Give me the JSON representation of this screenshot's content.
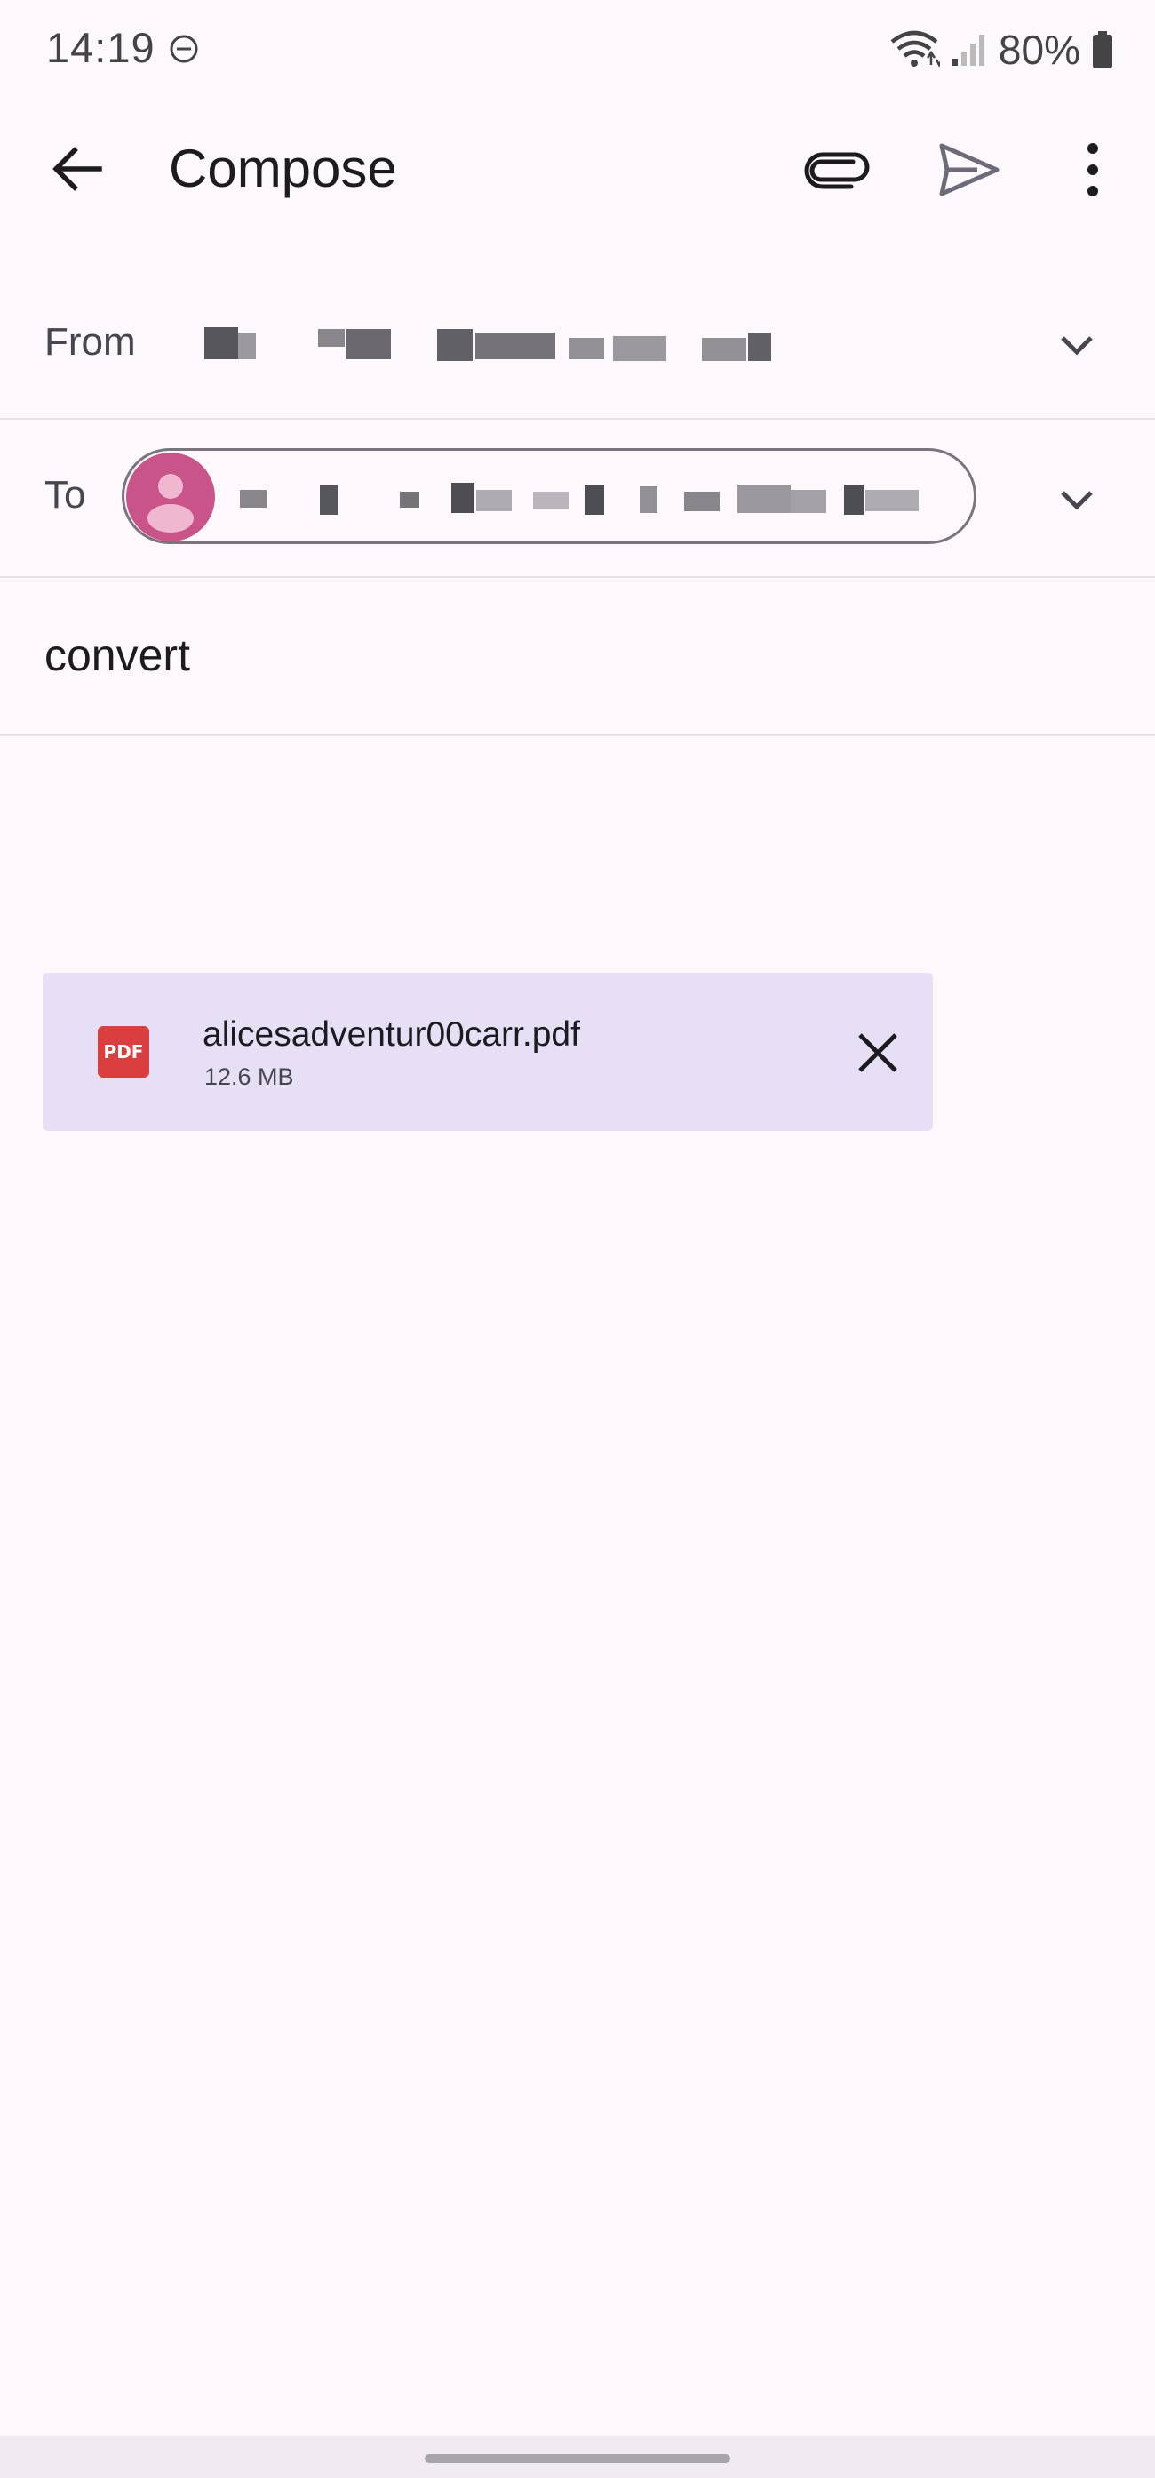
{
  "status_bar": {
    "time": "14:19",
    "battery_text": "80%",
    "icons": [
      "do-not-disturb-icon",
      "wifi-icon",
      "signal-icon",
      "battery-icon"
    ]
  },
  "app_bar": {
    "title": "Compose",
    "icons": [
      "back-arrow-icon",
      "paperclip-icon",
      "send-icon",
      "more-vert-icon"
    ]
  },
  "from": {
    "label": "From"
  },
  "to": {
    "label": "To"
  },
  "subject": {
    "value": "convert"
  },
  "attachment": {
    "filename": "alicesadventur00carr.pdf",
    "size": "12.6 MB",
    "type_badge": "PDF"
  },
  "colors": {
    "background": "#fdf8fc",
    "attachment_background": "#e6dff5",
    "avatar": "#c9548a",
    "pdf_red": "#db3e3e"
  }
}
